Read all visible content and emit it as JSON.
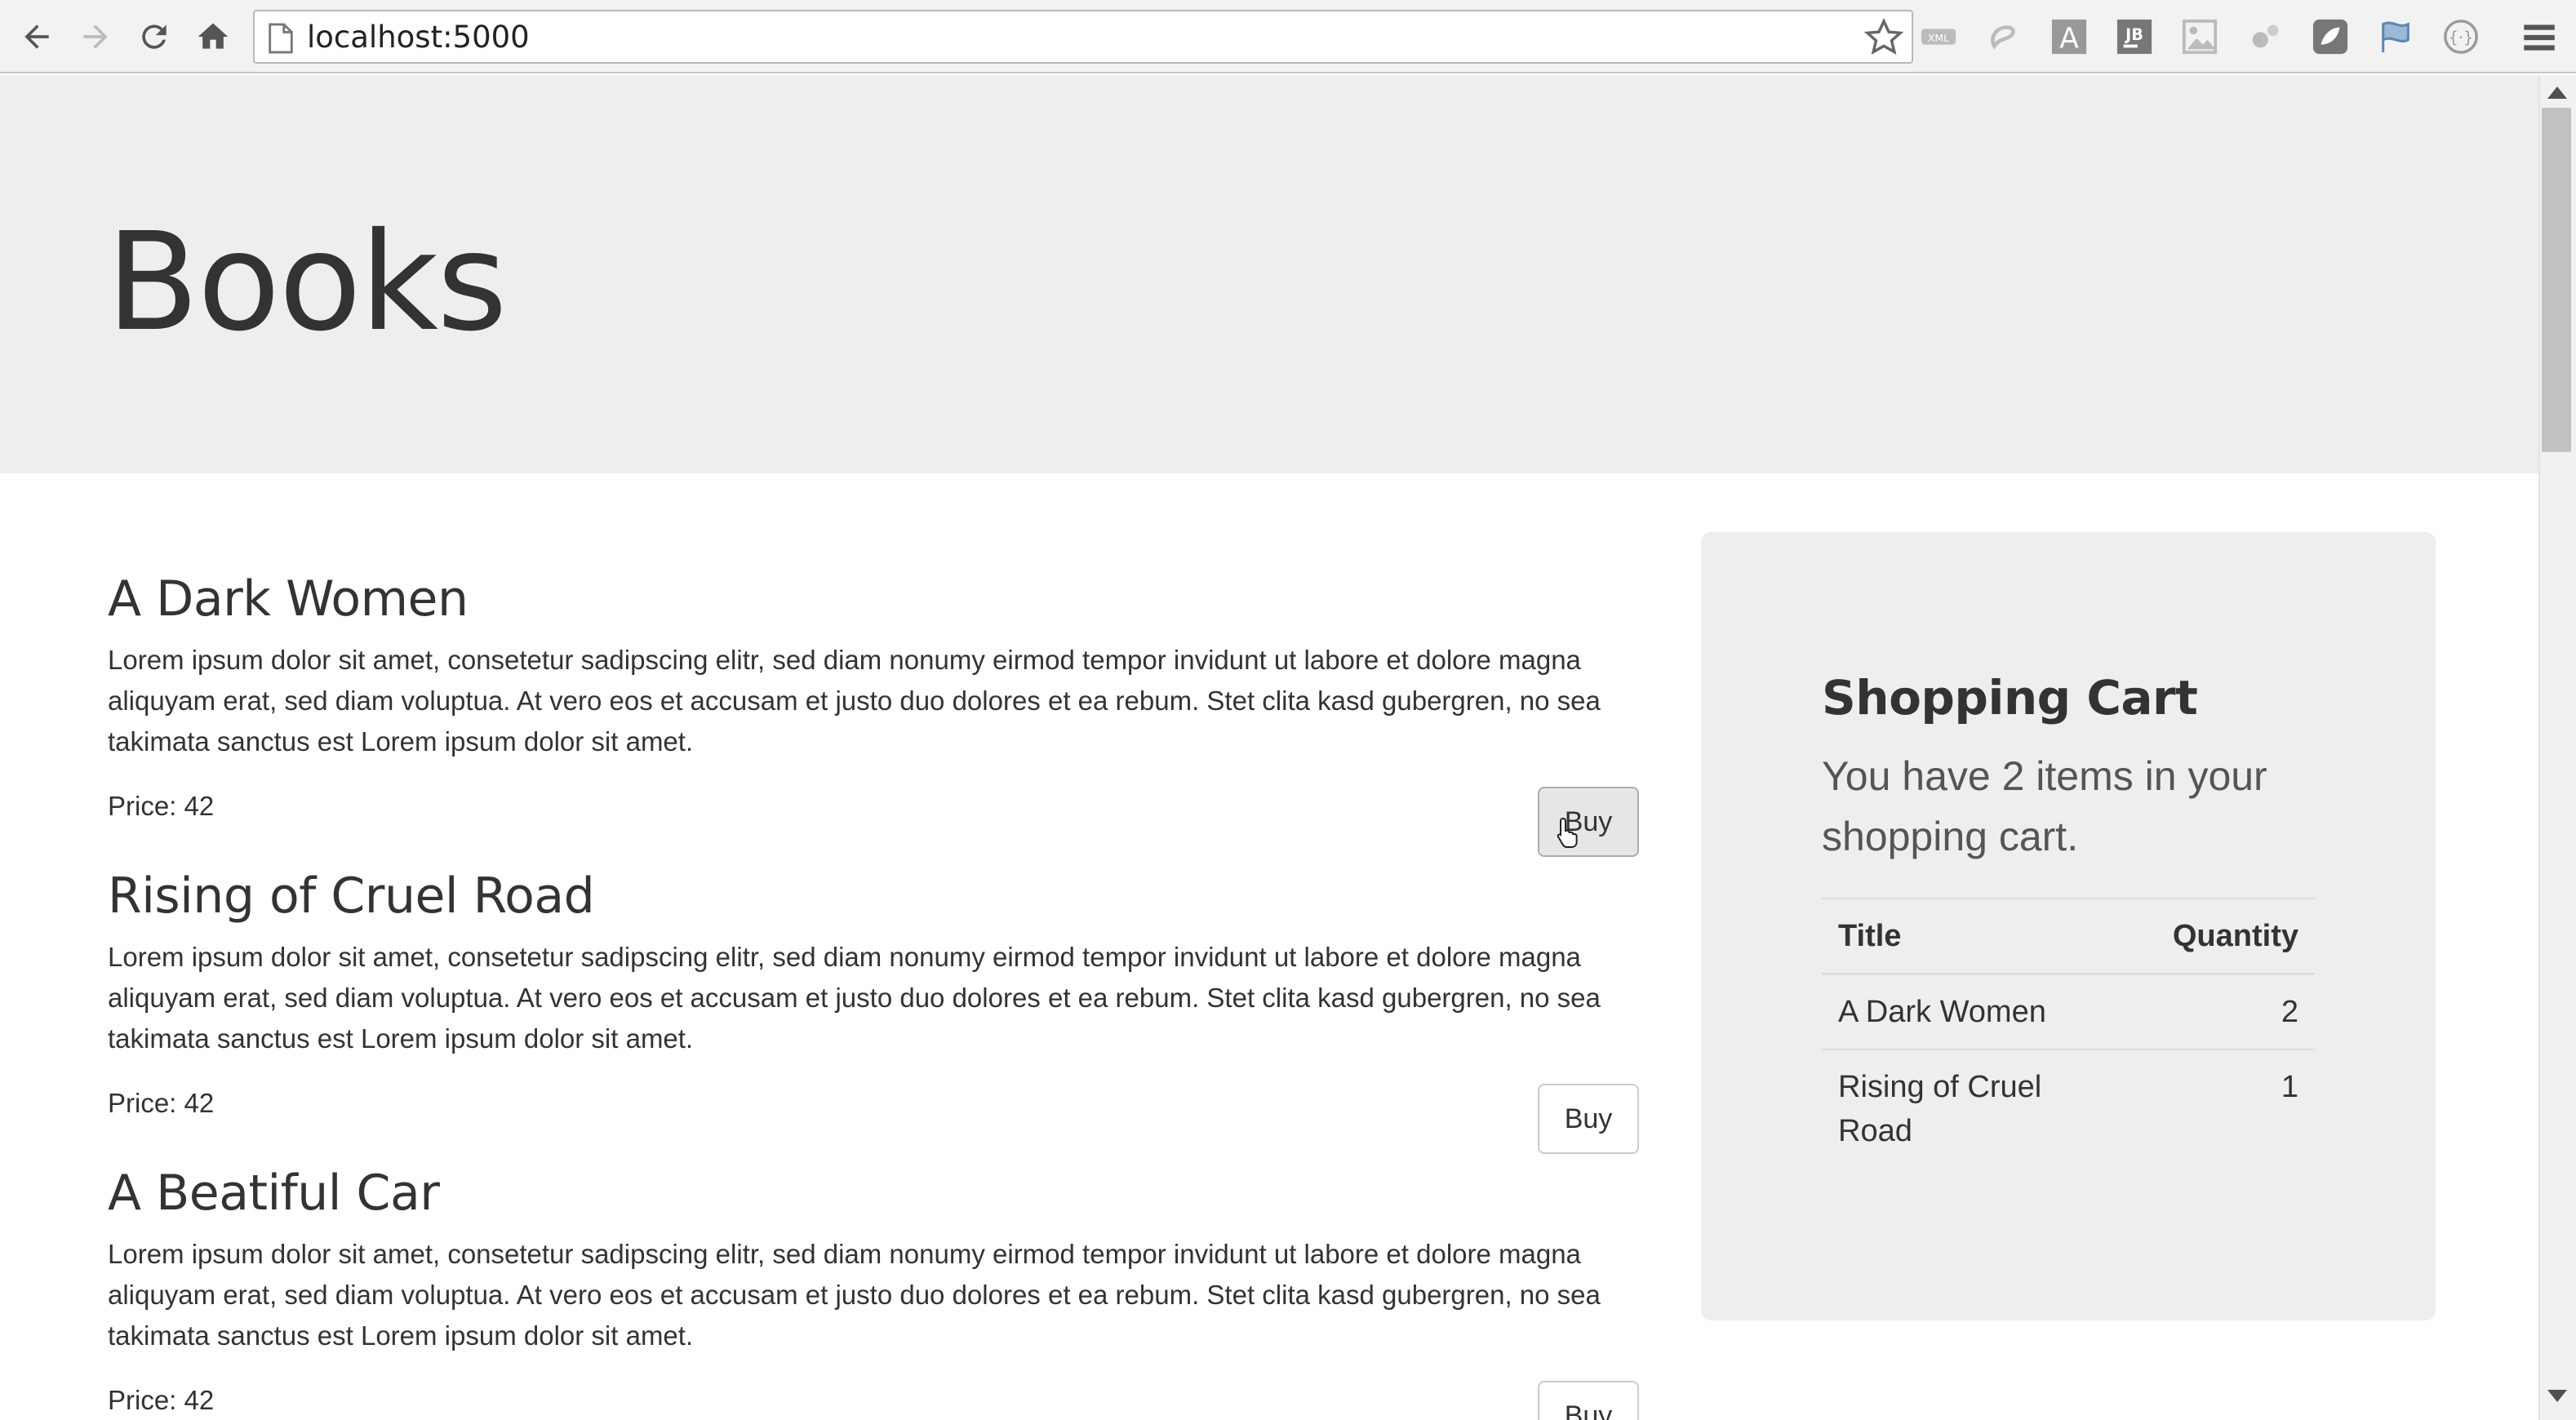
{
  "browser": {
    "url": "localhost:5000",
    "back_icon": "arrow-left-icon",
    "forward_icon": "arrow-right-icon",
    "reload_icon": "reload-icon",
    "home_icon": "home-icon",
    "bookmark_icon": "star-icon",
    "menu_icon": "hamburger-icon",
    "extensions": [
      "xml-icon",
      "swirl-icon",
      "font-a-icon",
      "jb-icon",
      "image-icon",
      "gear-icon",
      "shield-icon",
      "flag-icon",
      "code-braces-icon"
    ]
  },
  "page": {
    "title": "Books"
  },
  "books": [
    {
      "title": "A Dark Women",
      "description": "Lorem ipsum dolor sit amet, consetetur sadipscing elitr,  sed diam nonumy eirmod tempor invidunt ut labore et dolore magna aliquyam  erat, sed diam voluptua. At vero eos et accusam et justo duo dolores et ea  rebum. Stet clita kasd gubergren, no sea takimata sanctus est Lorem ipsum dolor sit amet.",
      "price": "Price: 42",
      "buy_label": "Buy"
    },
    {
      "title": "Rising of Cruel Road",
      "description": "Lorem ipsum dolor sit amet, consetetur sadipscing elitr,  sed diam nonumy eirmod tempor invidunt ut labore et dolore magna aliquyam  erat, sed diam voluptua. At vero eos et accusam et justo duo dolores et ea  rebum. Stet clita kasd gubergren, no sea takimata sanctus est Lorem ipsum dolor sit amet.",
      "price": "Price: 42",
      "buy_label": "Buy"
    },
    {
      "title": "A Beatiful Car",
      "description": "Lorem ipsum dolor sit amet, consetetur sadipscing elitr,  sed diam nonumy eirmod tempor invidunt ut labore et dolore magna aliquyam  erat, sed diam voluptua. At vero eos et accusam et justo duo dolores et ea  rebum. Stet clita kasd gubergren, no sea takimata sanctus est Lorem ipsum dolor sit amet.",
      "price": "Price: 42",
      "buy_label": "Buy"
    }
  ],
  "cart": {
    "title": "Shopping Cart",
    "summary": "You have 2 items in your shopping cart.",
    "columns": [
      "Title",
      "Quantity"
    ],
    "rows": [
      {
        "title": "A Dark Women",
        "quantity": "2"
      },
      {
        "title": "Rising of Cruel Road",
        "quantity": "1"
      }
    ]
  }
}
